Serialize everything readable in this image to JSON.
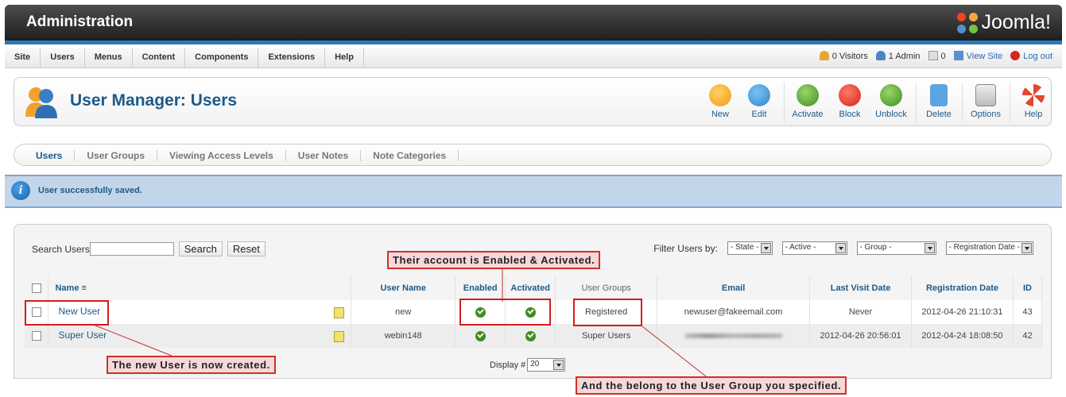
{
  "header": {
    "title": "Administration",
    "logo_text": "Joomla!"
  },
  "menu": {
    "items": [
      "Site",
      "Users",
      "Menus",
      "Content",
      "Components",
      "Extensions",
      "Help"
    ]
  },
  "status": {
    "visitors": "0 Visitors",
    "admins": "1 Admin",
    "messages": "0",
    "view_site": "View Site",
    "logout": "Log out"
  },
  "toolbar": {
    "page_title": "User Manager: Users",
    "buttons": [
      "New",
      "Edit",
      "Activate",
      "Block",
      "Unblock",
      "Delete",
      "Options",
      "Help"
    ]
  },
  "subnav": {
    "tabs": [
      "Users",
      "User Groups",
      "Viewing Access Levels",
      "User Notes",
      "Note Categories"
    ],
    "active": "Users"
  },
  "message": {
    "text": "User successfully saved."
  },
  "search": {
    "label": "Search Users",
    "value": "",
    "search_button": "Search",
    "reset_button": "Reset"
  },
  "filters": {
    "label": "Filter Users by:",
    "state": "- State -",
    "active": "- Active -",
    "group": "- Group -",
    "registration_date": "- Registration Date -"
  },
  "table": {
    "headers": [
      "Name",
      "User Name",
      "Enabled",
      "Activated",
      "User Groups",
      "Email",
      "Last Visit Date",
      "Registration Date",
      "ID"
    ],
    "rows": [
      {
        "name": "New User",
        "username": "new",
        "group": "Registered",
        "email": "newuser@fakeemail.com",
        "last_visit": "Never",
        "registered": "2012-04-26 21:10:31",
        "id": "43"
      },
      {
        "name": "Super User",
        "username": "webin148",
        "group": "Super Users",
        "email": "",
        "last_visit": "2012-04-26 20:56:01",
        "registered": "2012-04-24 18:08:50",
        "id": "42"
      }
    ]
  },
  "display": {
    "label": "Display #",
    "value": "20"
  },
  "annotations": {
    "enabled_activated": "Their account is Enabled & Activated.",
    "new_user": "The new User is now created.",
    "user_group": "And the belong to the User Group you specified."
  },
  "colors": {
    "accent": "#1d5a8a",
    "callout_border": "#d0302a",
    "callout_fill": "#f6d8d8",
    "message_bg": "#c3d5e8"
  }
}
